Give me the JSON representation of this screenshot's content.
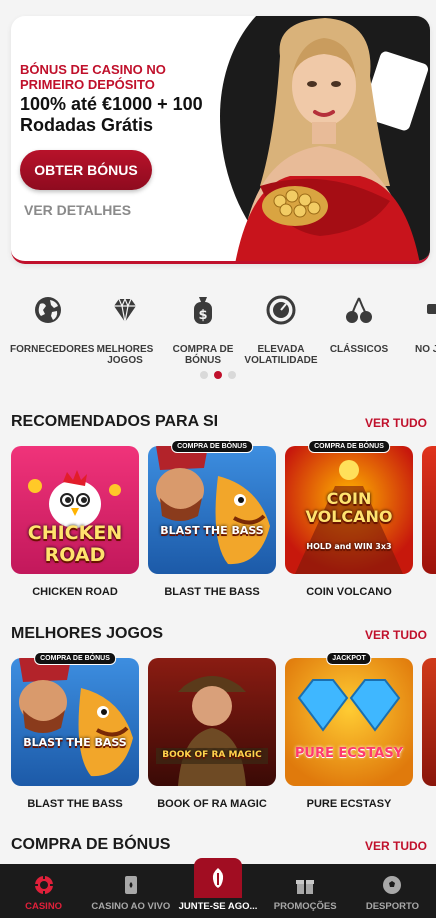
{
  "hero": {
    "kicker": "BÓNUS DE CASINO NO PRIMEIRO DEPÓSITO",
    "title": "100% até €1000 + 100 Rodadas Grátis",
    "cta": "OBTER BÓNUS",
    "link": "VER DETALHES"
  },
  "categories": [
    {
      "label": "FORNECEDORES",
      "icon": "globe-icon"
    },
    {
      "label": "MELHORES JOGOS",
      "icon": "diamond-icon"
    },
    {
      "label": "COMPRA DE BÓNUS",
      "icon": "money-bag-icon"
    },
    {
      "label": "ELEVADA VOLATILIDADE",
      "icon": "gauge-icon"
    },
    {
      "label": "CLÁSSICOS",
      "icon": "cherries-icon"
    },
    {
      "label": "NO JO",
      "icon": "partial-icon"
    }
  ],
  "pager": {
    "count": 3,
    "active": 1
  },
  "recommended": {
    "title": "RECOMENDADOS PARA SI",
    "link": "VER TUDO",
    "games": [
      {
        "name": "CHICKEN ROAD",
        "badge": "",
        "art": "CHICKEN ROAD"
      },
      {
        "name": "BLAST THE BASS",
        "badge": "COMPRA DE BÓNUS",
        "art": "BLAST THE BASS"
      },
      {
        "name": "COIN VOLCANO",
        "badge": "COMPRA DE BÓNUS",
        "art": "COIN VOLCANO",
        "art_sub": "HOLD and WIN 3x3"
      }
    ]
  },
  "best": {
    "title": "MELHORES JOGOS",
    "link": "VER TUDO",
    "games": [
      {
        "name": "BLAST THE BASS",
        "badge": "COMPRA DE BÓNUS",
        "art": "BLAST THE BASS"
      },
      {
        "name": "BOOK OF RA MAGIC",
        "badge": "",
        "art": "BOOK OF RA MAGIC"
      },
      {
        "name": "PURE ECSTASY",
        "badge": "JACKPOT",
        "art": "PURE ECSTASY"
      }
    ]
  },
  "bonus_section": {
    "title": "COMPRA DE BÓNUS",
    "link": "VER TUDO"
  },
  "nav": [
    {
      "label": "CASINO",
      "icon": "casino-chip-icon",
      "active": true
    },
    {
      "label": "CASINO AO VIVO",
      "icon": "playing-card-icon",
      "active": false
    },
    {
      "label": "JUNTE-SE AGO...",
      "icon": "join-icon",
      "active": false
    },
    {
      "label": "PROMOÇÕES",
      "icon": "gift-icon",
      "active": false
    },
    {
      "label": "DESPORTO",
      "icon": "soccer-ball-icon",
      "active": false
    }
  ],
  "colors": {
    "brand": "#c0102b",
    "nav_bg": "#1b1b1b"
  }
}
